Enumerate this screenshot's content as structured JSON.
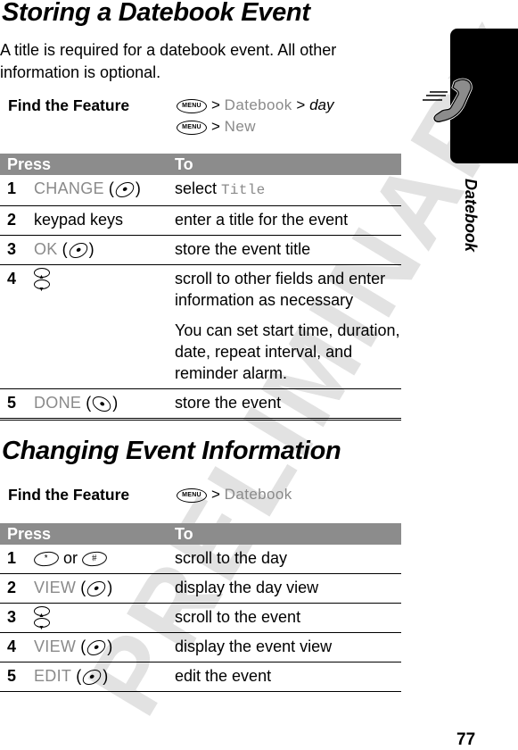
{
  "watermark": "PRELIMINARY",
  "sidebar": {
    "section_label": "Datebook",
    "tab_icon": "phone-handset-icon"
  },
  "page_number": "77",
  "section1": {
    "title": "Storing a Datebook Event",
    "intro": "A title is required for a datebook event. All other information is optional.",
    "find_feature": {
      "label": "Find the Feature",
      "paths": [
        {
          "key": "MENU",
          "steps": [
            {
              "text": "Datebook",
              "style": "softkey"
            },
            {
              "text": "day",
              "style": "italic"
            }
          ]
        },
        {
          "key": "MENU",
          "steps": [
            {
              "text": "New",
              "style": "softkey"
            }
          ]
        }
      ],
      "sep": ">"
    },
    "table": {
      "headers": {
        "press": "Press",
        "to": "To"
      },
      "rows": [
        {
          "num": "1",
          "press_soft": "CHANGE",
          "press_key": "select-key",
          "to": "select ",
          "to_soft": "Title"
        },
        {
          "num": "2",
          "press_text": "keypad keys",
          "to": "enter a title for the event"
        },
        {
          "num": "3",
          "press_soft": "OK",
          "press_key": "select-key",
          "to": "store the event title"
        },
        {
          "num": "4",
          "press_key": "nav-key",
          "to": "scroll to other fields and enter information as necessary",
          "note": "You can set start time, duration, date, repeat interval, and reminder alarm."
        },
        {
          "num": "5",
          "press_soft": "DONE",
          "press_key": "right-soft-key",
          "to": "store the event"
        }
      ]
    }
  },
  "section2": {
    "title": "Changing Event Information",
    "find_feature": {
      "label": "Find the Feature",
      "paths": [
        {
          "key": "MENU",
          "steps": [
            {
              "text": "Datebook",
              "style": "softkey"
            }
          ]
        }
      ],
      "sep": ">"
    },
    "table": {
      "headers": {
        "press": "Press",
        "to": "To"
      },
      "rows": [
        {
          "num": "1",
          "press_key_a": "*",
          "press_or": "or",
          "press_key_b": "#",
          "to": "scroll to the day"
        },
        {
          "num": "2",
          "press_soft": "VIEW",
          "press_key": "select-key",
          "to": "display the day view"
        },
        {
          "num": "3",
          "press_key": "nav-key",
          "to": "scroll to the event"
        },
        {
          "num": "4",
          "press_soft": "VIEW",
          "press_key": "select-key",
          "to": "display the event view"
        },
        {
          "num": "5",
          "press_soft": "EDIT",
          "press_key": "select-key",
          "to": "edit the event"
        }
      ]
    }
  }
}
